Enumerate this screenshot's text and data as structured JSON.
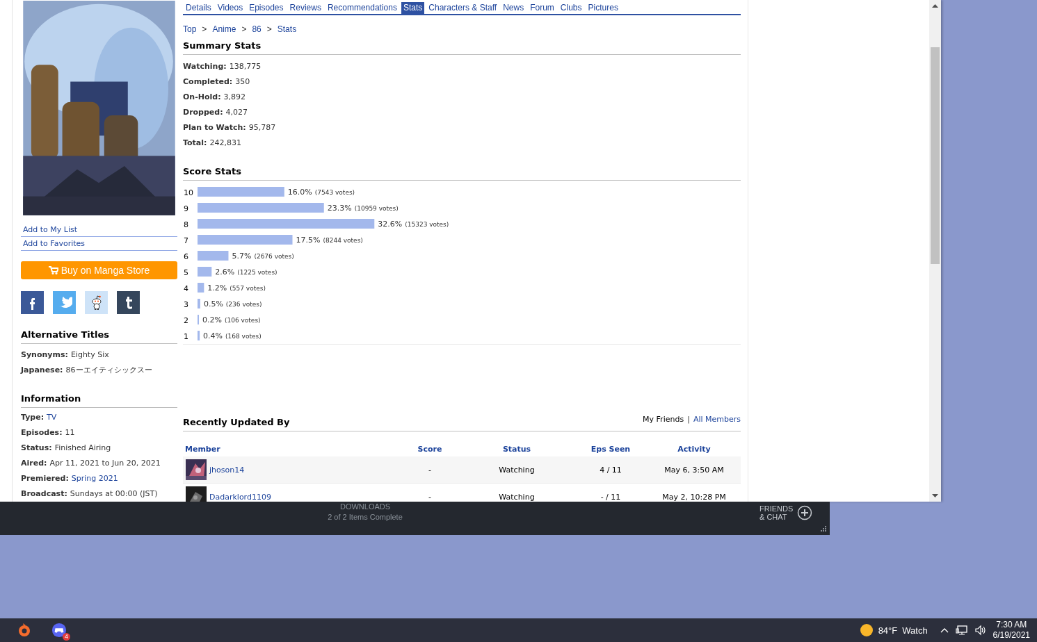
{
  "browser": {
    "sidebar": {
      "actions": [
        "Add to My List",
        "Add to Favorites"
      ],
      "buy_button": "Buy on Manga Store",
      "share": [
        {
          "kind": "facebook"
        },
        {
          "kind": "twitter"
        },
        {
          "kind": "reddit"
        },
        {
          "kind": "tumblr"
        }
      ],
      "sections": [
        {
          "title": "Alternative Titles",
          "fields": [
            {
              "label": "Synonyms:",
              "value": "Eighty Six",
              "link": false
            },
            {
              "label": "Japanese:",
              "value": "86ーエイティシックスー",
              "link": false
            }
          ]
        },
        {
          "title": "Information",
          "fields": [
            {
              "label": "Type:",
              "value": "TV",
              "link": true
            },
            {
              "label": "Episodes:",
              "value": "11",
              "link": false
            },
            {
              "label": "Status:",
              "value": "Finished Airing",
              "link": false
            },
            {
              "label": "Aired:",
              "value": "Apr 11, 2021 to Jun 20, 2021",
              "link": false
            },
            {
              "label": "Premiered:",
              "value": "Spring 2021",
              "link": true
            },
            {
              "label": "Broadcast:",
              "value": "Sundays at 00:00 (JST)",
              "link": false
            }
          ]
        }
      ]
    },
    "tabs": [
      {
        "label": "Details",
        "selected": false
      },
      {
        "label": "Videos",
        "selected": false
      },
      {
        "label": "Episodes",
        "selected": false
      },
      {
        "label": "Reviews",
        "selected": false
      },
      {
        "label": "Recommendations",
        "selected": false
      },
      {
        "label": "Stats",
        "selected": true
      },
      {
        "label": "Characters & Staff",
        "selected": false
      },
      {
        "label": "News",
        "selected": false
      },
      {
        "label": "Forum",
        "selected": false
      },
      {
        "label": "Clubs",
        "selected": false
      },
      {
        "label": "Pictures",
        "selected": false
      }
    ],
    "breadcrumb": {
      "items": [
        "Top",
        "Anime",
        "86",
        "Stats"
      ],
      "separator": ">"
    },
    "summary_stats": {
      "title": "Summary Stats",
      "items": [
        {
          "label": "Watching:",
          "value": "138,775"
        },
        {
          "label": "Completed:",
          "value": "350"
        },
        {
          "label": "On-Hold:",
          "value": "3,892"
        },
        {
          "label": "Dropped:",
          "value": "4,027"
        },
        {
          "label": "Plan to Watch:",
          "value": "95,787"
        },
        {
          "label": "Total:",
          "value": "242,831"
        }
      ]
    },
    "score_stats": {
      "title": "Score Stats",
      "chart_data": {
        "type": "bar",
        "orientation": "horizontal",
        "categories": [
          "10",
          "9",
          "8",
          "7",
          "6",
          "5",
          "4",
          "3",
          "2",
          "1"
        ],
        "values": [
          16.0,
          23.3,
          32.6,
          17.5,
          5.7,
          2.6,
          1.2,
          0.5,
          0.2,
          0.4
        ],
        "value_labels": [
          "16.0%",
          "23.3%",
          "32.6%",
          "17.5%",
          "5.7%",
          "2.6%",
          "1.2%",
          "0.5%",
          "0.2%",
          "0.4%"
        ],
        "annotations": [
          {
            "text": "(7543 votes)"
          },
          {
            "text": "(10959 votes)"
          },
          {
            "text": "(15323 votes)"
          },
          {
            "text": "(8244 votes)"
          },
          {
            "text": "(2676 votes)"
          },
          {
            "text": "(1225 votes)"
          },
          {
            "text": "(557 votes)"
          },
          {
            "text": "(236 votes)"
          },
          {
            "text": "(106 votes)"
          },
          {
            "text": "(168 votes)"
          }
        ]
      }
    },
    "recent": {
      "title": "Recently Updated By",
      "filters": [
        {
          "label": "My Friends",
          "selected": true
        },
        {
          "label": "All Members",
          "selected": false
        }
      ],
      "separator": "|",
      "columns": [
        "Member",
        "Score",
        "Status",
        "Eps Seen",
        "Activity"
      ],
      "rows": [
        {
          "member": "jhoson14",
          "score": "-",
          "status": "Watching",
          "eps_seen": "4 / 11",
          "activity": "May 6, 3:50 AM"
        },
        {
          "member": "Dadarklord1109",
          "score": "-",
          "status": "Watching",
          "eps_seen": "- / 11",
          "activity": "May 2, 10:28 PM"
        }
      ]
    }
  },
  "steam": {
    "downloads_title": "DOWNLOADS",
    "downloads_status": "2 of 2 Items Complete",
    "friends": [
      "FRIENDS",
      "& CHAT"
    ]
  },
  "taskbar": {
    "apps": [
      {
        "kind": "ring"
      },
      {
        "kind": "gamepad",
        "badge": "4"
      }
    ],
    "weather": {
      "temperature": "84°F",
      "text": "Watch"
    },
    "time": "7:30 AM",
    "date": "6/19/2021"
  }
}
